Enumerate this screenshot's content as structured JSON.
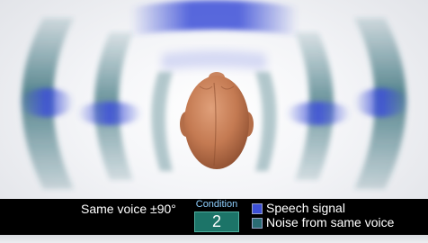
{
  "caption": {
    "condition_text": "Same voice ±90°",
    "condition_label": "Condition",
    "condition_number": "2"
  },
  "legend": {
    "items": [
      {
        "label": "Speech signal",
        "color": "#3c4fd6"
      },
      {
        "label": "Noise from same voice",
        "color": "#2a6b73"
      }
    ]
  },
  "colors": {
    "speech_wave": "#3c4fd6",
    "noise_wave": "#2f6a74",
    "head": "#c8815a",
    "caption_background": "#000000",
    "condition_label": "#8fd0ff",
    "condition_box": "#1c7468"
  }
}
